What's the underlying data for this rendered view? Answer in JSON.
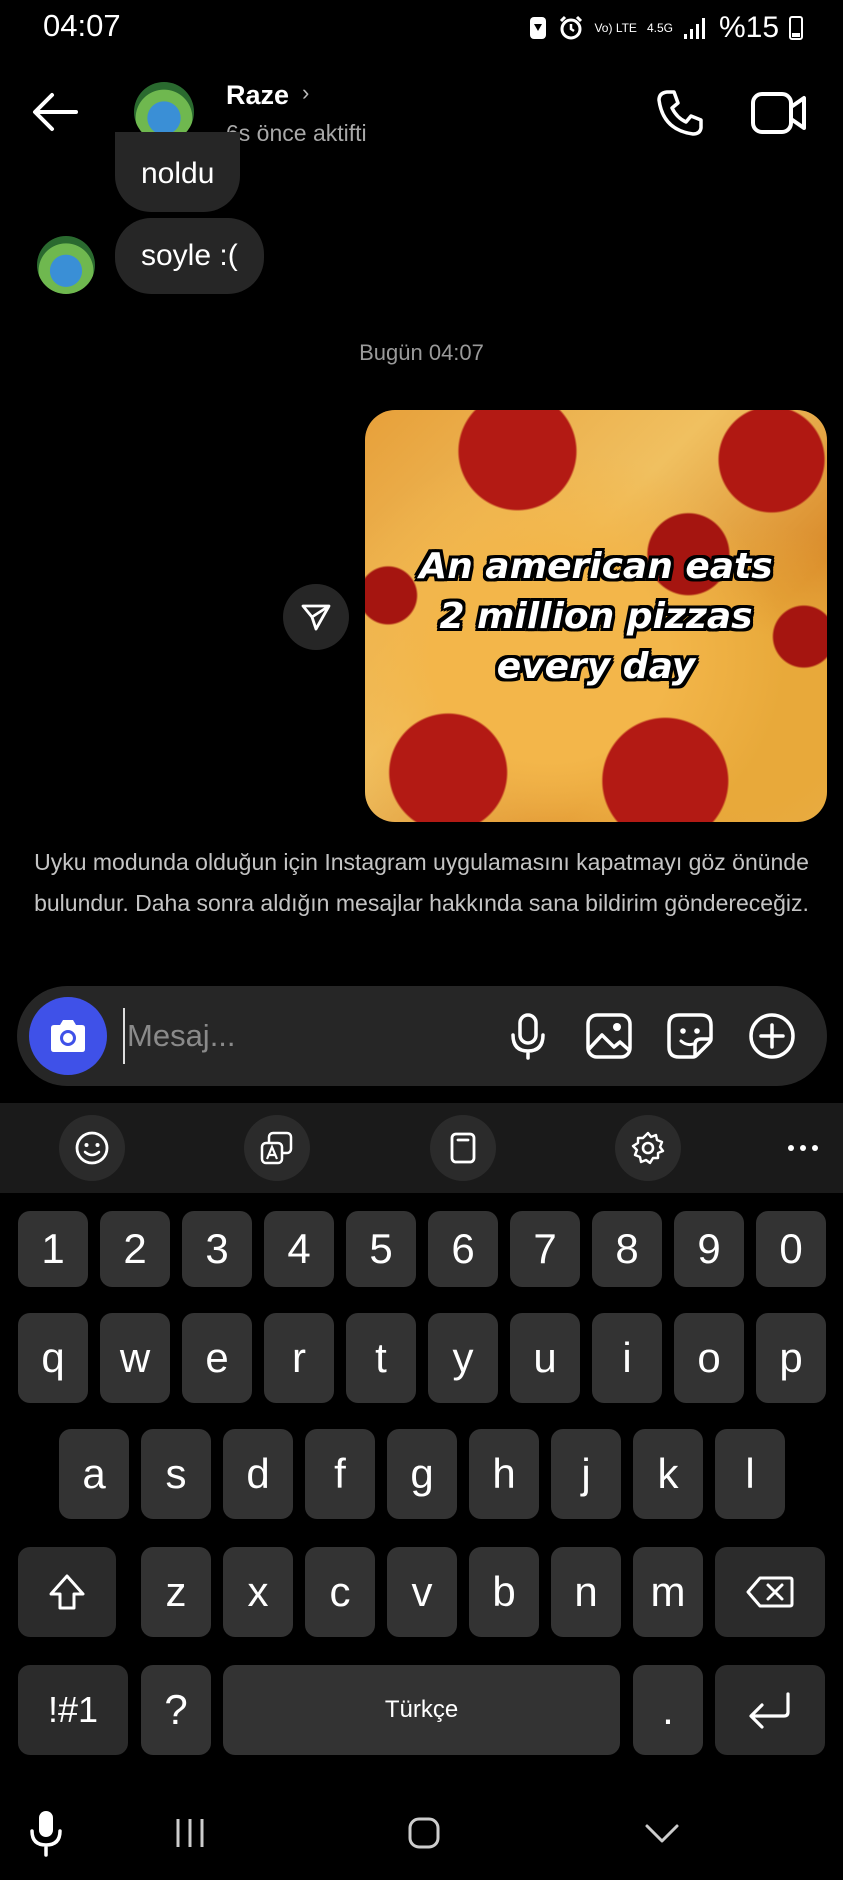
{
  "status_bar": {
    "time": "04:07",
    "network": "Vo) LTE",
    "network_gen": "4.5G",
    "battery": "%15"
  },
  "header": {
    "contact_name": "Raze",
    "contact_status": "6s önce aktifti"
  },
  "messages": [
    {
      "from": "contact",
      "text": "noldu"
    },
    {
      "from": "contact",
      "text": "soyle :("
    }
  ],
  "timestamp": "Bugün 04:07",
  "image_message": {
    "meme_lines": [
      "An american eats",
      "2 million pizzas",
      "every day"
    ]
  },
  "notice": "Uyku modunda olduğun için Instagram uygulamasını kapatmayı göz önünde bulundur. Daha sonra aldığın mesajlar hakkında sana bildirim göndereceğiz.",
  "composer": {
    "placeholder": "Mesaj..."
  },
  "keyboard": {
    "row_numbers": [
      "1",
      "2",
      "3",
      "4",
      "5",
      "6",
      "7",
      "8",
      "9",
      "0"
    ],
    "row_1": [
      "q",
      "w",
      "e",
      "r",
      "t",
      "y",
      "u",
      "i",
      "o",
      "p"
    ],
    "row_2": [
      "a",
      "s",
      "d",
      "f",
      "g",
      "h",
      "j",
      "k",
      "l"
    ],
    "row_3": [
      "z",
      "x",
      "c",
      "v",
      "b",
      "n",
      "m"
    ],
    "symbols_key": "!#1",
    "question_key": "?",
    "space_label": "Türkçe",
    "period_key": "."
  },
  "colors": {
    "background": "#000000",
    "bubble": "#262626",
    "camera_button": "#3f51e8",
    "key": "#333333"
  }
}
